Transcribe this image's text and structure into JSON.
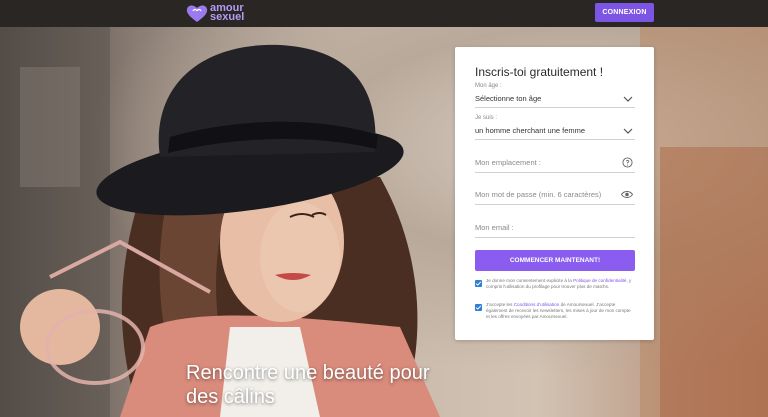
{
  "header": {
    "logo_line1": "amour",
    "logo_line2": "sexuel",
    "connexion_label": "CONNEXION"
  },
  "hero": {
    "tagline_line1": "Rencontre une beauté pour",
    "tagline_line2": "des câlins"
  },
  "form": {
    "title": "Inscris-toi gratuitement !",
    "age_label": "Mon âge :",
    "age_value": "Sélectionne ton âge",
    "gender_label": "Je suis :",
    "gender_value": "un homme cherchant une femme",
    "location_placeholder": "Mon emplacement :",
    "password_placeholder": "Mon mot de passe (min. 6 caractères)",
    "email_placeholder": "Mon email :",
    "submit_label": "COMMENCER MAINTENANT!",
    "consent1_pre": "Je donne mon consentement explicite à la",
    "consent1_link": "Politique de confidentialité",
    "consent1_post": ", y compris l'utilisation du profilage pour trouver plus de matchs.",
    "consent2_pre": "J'accepte les",
    "consent2_link": "Conditions d'utilisation",
    "consent2_post": "de Amoursexuel. J'accepte également de recevoir les newsletters, les mises à jour de mon compte et les offres envoyées par Amoursexuel."
  },
  "colors": {
    "accent": "#8b5cf0",
    "header_bg": "#2a2624",
    "checkbox": "#2f7fd6"
  },
  "icons": [
    "heart-logo-icon",
    "chevron-down-icon",
    "help-circle-icon",
    "eye-icon",
    "check-icon"
  ]
}
